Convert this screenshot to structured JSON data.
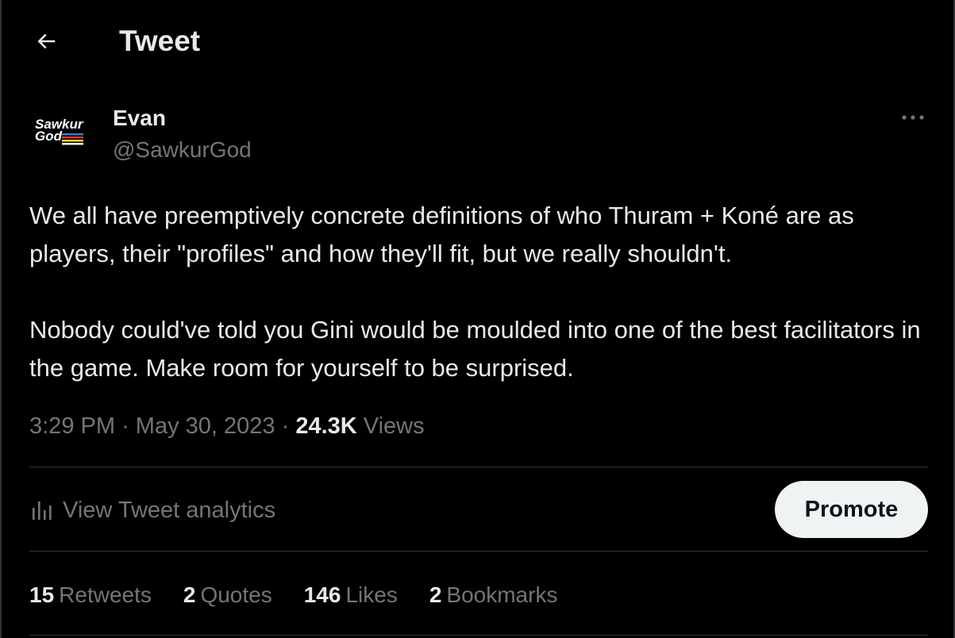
{
  "header": {
    "title": "Tweet",
    "back_icon": "arrow-left-icon"
  },
  "author": {
    "name": "Evan",
    "handle": "@SawkurGod",
    "avatar_text_line1": "Sawkur",
    "avatar_text_line2": "God"
  },
  "tweet": {
    "paragraphs": [
      "We all have preemptively concrete definitions of who Thuram + Koné are as players, their \"profiles\" and how they'll fit, but we really shouldn't.",
      "Nobody could've told you Gini would be moulded into one of the best facilitators in the game. Make room for yourself to be surprised."
    ],
    "time": "3:29 PM",
    "separator": "·",
    "date": "May 30, 2023",
    "views_count": "24.3K",
    "views_label": "Views"
  },
  "analytics": {
    "label": "View Tweet analytics",
    "icon": "analytics-bars-icon"
  },
  "promote": {
    "label": "Promote"
  },
  "stats": [
    {
      "count": "15",
      "label": "Retweets"
    },
    {
      "count": "2",
      "label": "Quotes"
    },
    {
      "count": "146",
      "label": "Likes"
    },
    {
      "count": "2",
      "label": "Bookmarks"
    }
  ],
  "colors": {
    "background": "#000000",
    "text": "#e7e9ea",
    "muted": "#71767b",
    "divider": "#2f3336",
    "button": "#eff3f4"
  }
}
